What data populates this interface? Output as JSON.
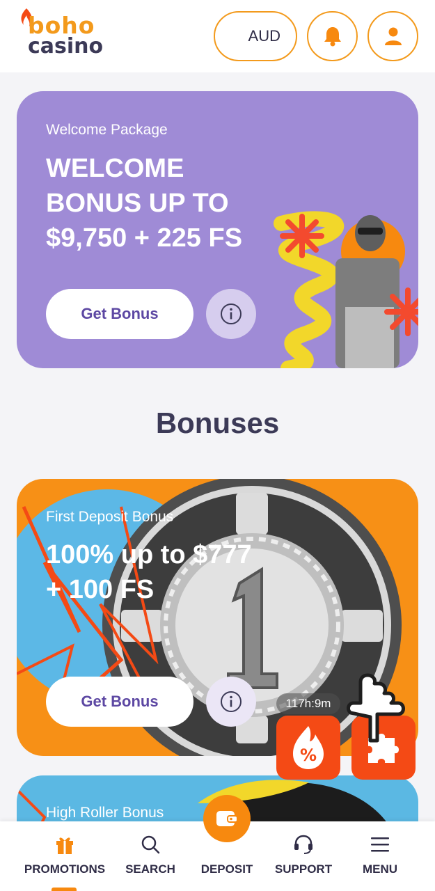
{
  "header": {
    "logo_top": "boho",
    "logo_bottom": "casino",
    "currency": "AUD"
  },
  "welcome": {
    "subtitle": "Welcome Package",
    "title": "WELCOME BONUS UP TO $9,750 + 225 FS",
    "button": "Get Bonus"
  },
  "section": {
    "heading": "Bonuses"
  },
  "bonuses": [
    {
      "subtitle": "First Deposit Bonus",
      "title": "100% up to $777 + 100 FS",
      "button": "Get Bonus"
    },
    {
      "subtitle": "High Roller Bonus"
    }
  ],
  "widgets": {
    "timer": "117h:9m",
    "promo_symbol": "%"
  },
  "bottom_nav": {
    "items": [
      {
        "label": "PROMOTIONS",
        "icon": "gift-icon"
      },
      {
        "label": "SEARCH",
        "icon": "search-icon"
      },
      {
        "label": "DEPOSIT",
        "icon": "wallet-icon"
      },
      {
        "label": "SUPPORT",
        "icon": "headset-icon"
      },
      {
        "label": "MENU",
        "icon": "hamburger-icon"
      }
    ],
    "active": "PROMOTIONS"
  },
  "colors": {
    "accent": "#f7890f",
    "welcome_bg": "#9f8bd6",
    "bonus_orange": "#f79016",
    "bonus_blue": "#5bb8e3",
    "text_dark": "#3c3a57",
    "button_text": "#5d48a3"
  }
}
